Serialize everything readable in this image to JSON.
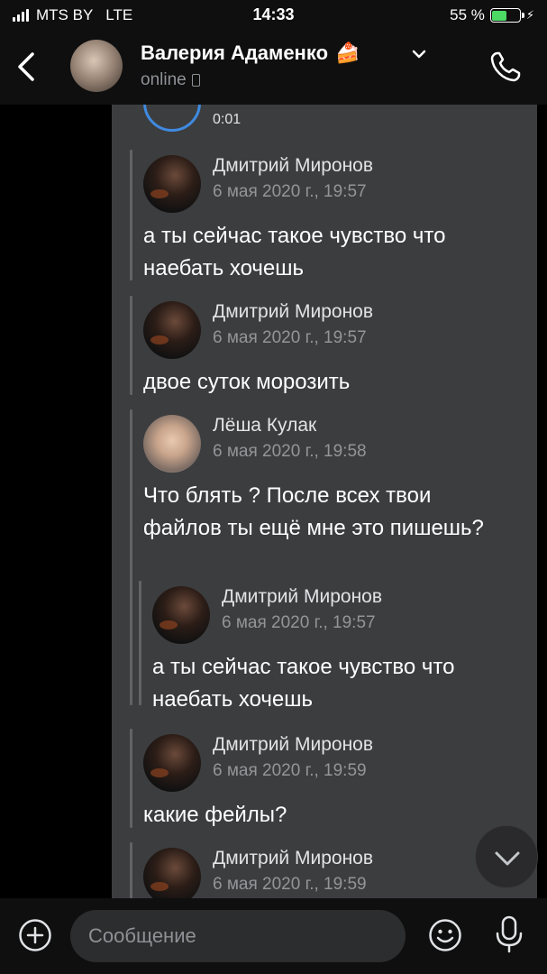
{
  "status_bar": {
    "carrier": "MTS BY",
    "network": "LTE",
    "time": "14:33",
    "battery": "55 %",
    "battery_level": 0.55
  },
  "header": {
    "name": "Валерия Адаменко",
    "status": "online",
    "icons": [
      "back-icon",
      "cake-icon",
      "chevron-down-icon",
      "phone-icon"
    ]
  },
  "voice_message": {
    "duration": "0:01"
  },
  "messages": [
    {
      "author": "Дмитрий Миронов",
      "date": "6 мая 2020 г., 19:57",
      "text": "а ты сейчас такое чувство что наебать хочешь"
    },
    {
      "author": "Дмитрий Миронов",
      "date": "6 мая 2020 г., 19:57",
      "text": "двое суток морозить"
    },
    {
      "author": "Лёша Кулак",
      "date": "6 мая 2020 г., 19:58",
      "text": "Что блять ? После всех твои файлов ты ещё мне это пишешь?",
      "quoted": {
        "author": "Дмитрий Миронов",
        "date": "6 мая 2020 г., 19:57",
        "text": "а ты сейчас такое чувство что наебать хочешь"
      }
    },
    {
      "author": "Дмитрий Миронов",
      "date": "6 мая 2020 г., 19:59",
      "text": "какие фейлы?"
    },
    {
      "author": "Дмитрий Миронов",
      "date": "6 мая 2020 г., 19:59",
      "text": ""
    }
  ],
  "composer": {
    "placeholder": "Сообщение",
    "icons": [
      "plus-icon",
      "emoji-icon",
      "microphone-icon"
    ]
  }
}
